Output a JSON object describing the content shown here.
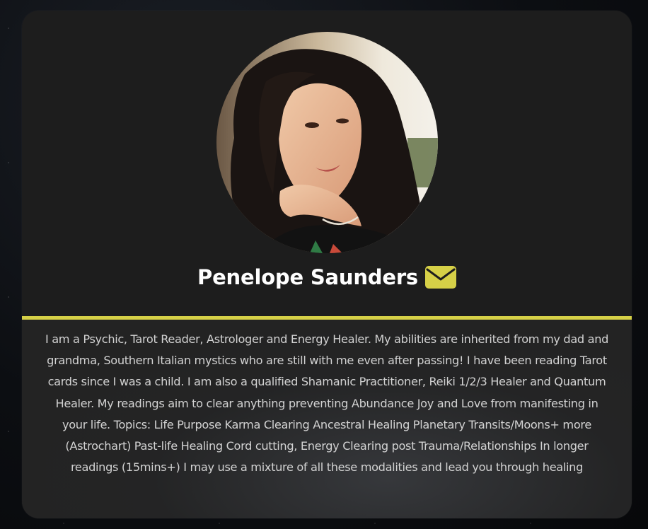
{
  "profile": {
    "name": "Penelope Saunders",
    "bio": "I am a Psychic, Tarot Reader, Astrologer and Energy Healer. My abilities are inherited from my dad and grandma, Southern Italian mystics who are still with me even after passing! I have been reading Tarot cards since I was a child. I am also a qualified Shamanic Practitioner, Reiki 1/2/3 Healer and Quantum Healer. My readings aim to clear anything preventing Abundance Joy and Love from manifesting in your life. Topics: Life Purpose Karma Clearing Ancestral Healing Planetary Transits/Moons+ more (Astrochart) Past-life Healing Cord cutting, Energy Clearing post Trauma/Relationships In longer readings (15mins+) I may use a mixture of all these modalities and lead you through healing",
    "contact_icon": "envelope-icon",
    "avatar_icon": "profile-photo"
  },
  "colors": {
    "accent": "#d6d047",
    "card_background": "#1f1f1f",
    "name_text": "#ffffff",
    "bio_text": "#d2d2d2"
  }
}
